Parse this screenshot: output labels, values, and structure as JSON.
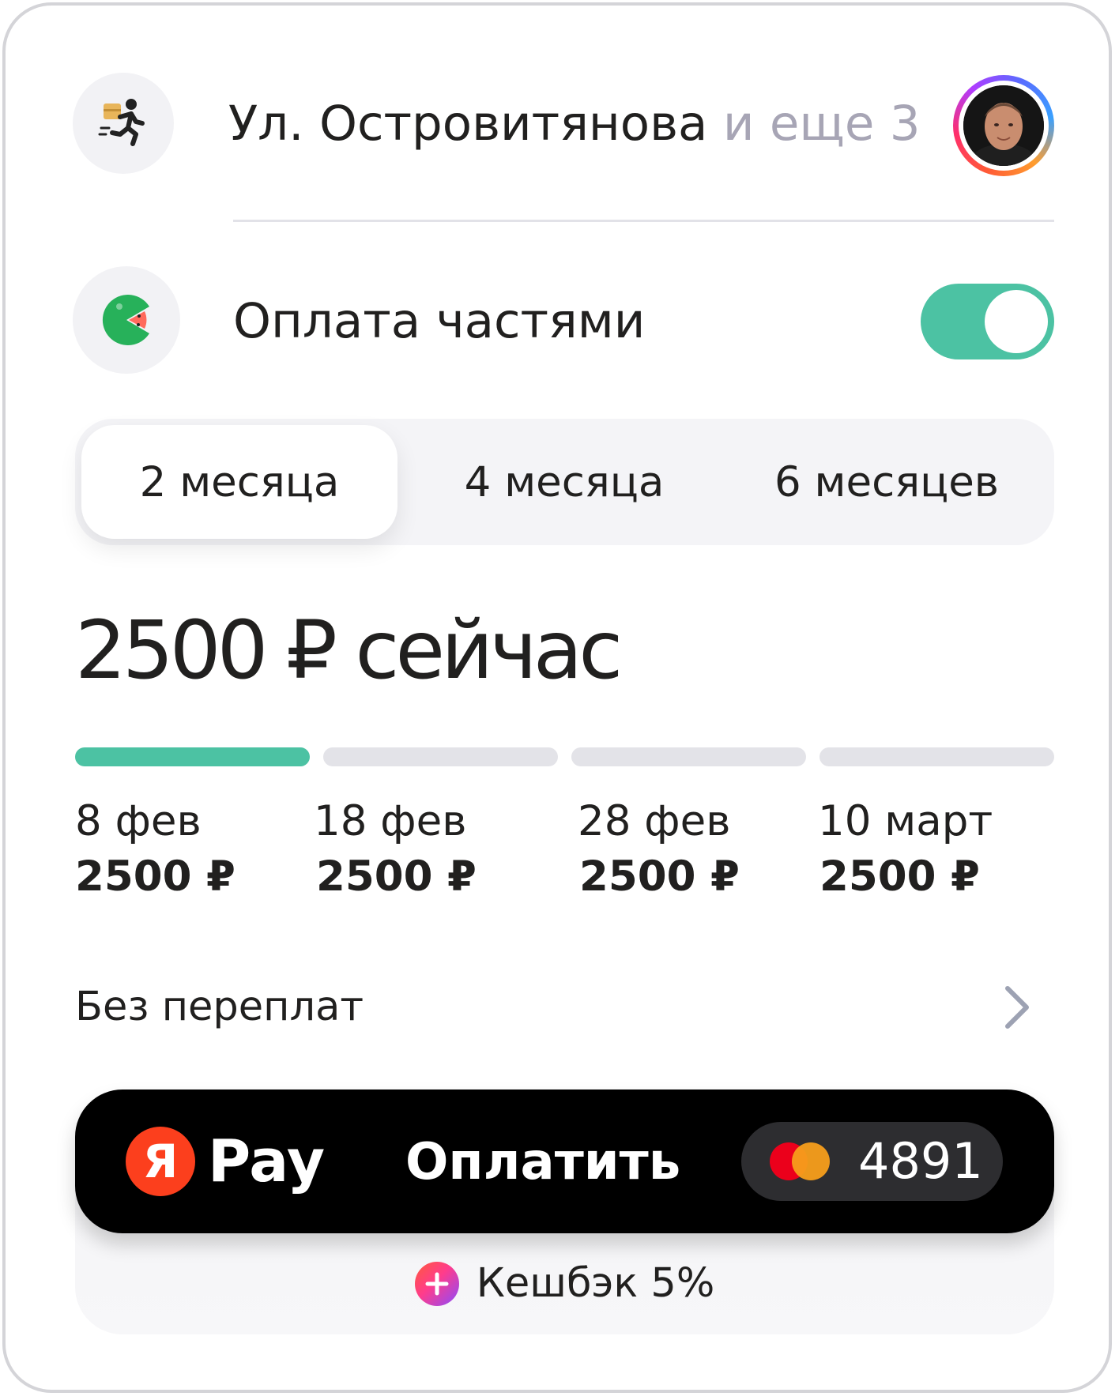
{
  "delivery": {
    "address": "Ул. Островитянова",
    "more": "и еще 3",
    "icon": "running-courier-icon"
  },
  "installments": {
    "label": "Оплата частями",
    "enabled": true,
    "icon": "watermelon-pacman-icon"
  },
  "terms": {
    "options": [
      "2 месяца",
      "4 месяца",
      "6 месяцев"
    ],
    "selected": "2 месяца"
  },
  "amount_now": "2500 ₽ сейчас",
  "schedule": {
    "paid_parts": 1,
    "total_parts": 4,
    "items": [
      {
        "date": "8 фев",
        "amount": "2500 ₽"
      },
      {
        "date": "18 фев",
        "amount": "2500 ₽"
      },
      {
        "date": "28 фев",
        "amount": "2500 ₽"
      },
      {
        "date": "10 март",
        "amount": "2500 ₽"
      }
    ]
  },
  "no_overpay": "Без переплат",
  "pay_button": {
    "logo_letter": "Я",
    "brand": "Pay",
    "label": "Оплатить",
    "card_last4": "4891",
    "card_brand_icon": "mastercard-icon"
  },
  "cashback": "Кешбэк 5%",
  "colors": {
    "accent": "#4cc2a3",
    "yandex_red": "#fc3f1d",
    "muted_text": "#a7a5b5"
  }
}
